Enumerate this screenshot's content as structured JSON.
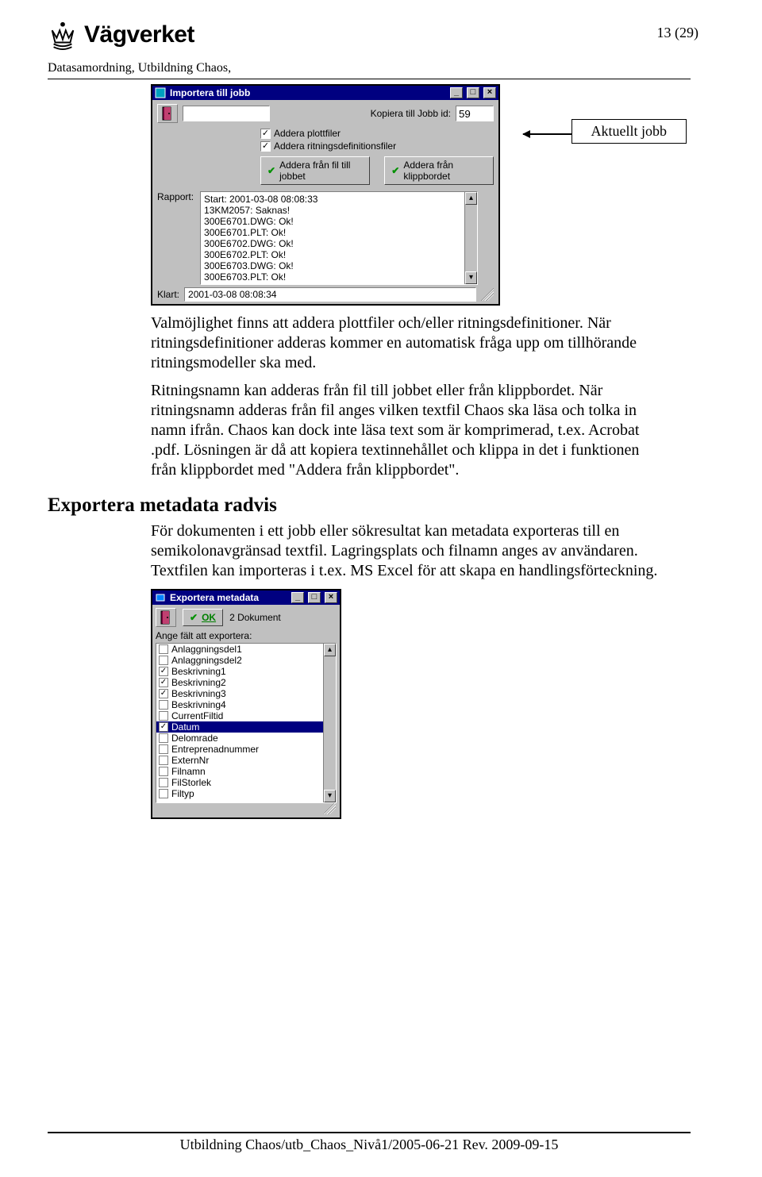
{
  "header": {
    "logo_text": "Vägverket",
    "page_number": "13 (29)",
    "doc_meta": "Datasamordning, Utbildning Chaos,"
  },
  "callout": {
    "label": "Aktuellt jobb"
  },
  "window1": {
    "title": "Importera till jobb",
    "jobid_label": "Kopiera till Jobb id:",
    "jobid_value": "59",
    "chk1": "Addera plottfiler",
    "chk2": "Addera ritningsdefinitionsfiler",
    "btn1": "Addera från fil till jobbet",
    "btn2": "Addera från klippbordet",
    "rpt_label": "Rapport:",
    "rpt_lines": [
      "Start: 2001-03-08 08:08:33",
      "13KM2057: Saknas!",
      "300E6701.DWG: Ok!",
      "300E6701.PLT: Ok!",
      "300E6702.DWG: Ok!",
      "300E6702.PLT: Ok!",
      "300E6703.DWG: Ok!",
      "300E6703.PLT: Ok!"
    ],
    "status_label": "Klart:",
    "status_value": "2001-03-08 08:08:34"
  },
  "paragraphs": {
    "p1": "Valmöjlighet finns att addera plottfiler och/eller ritningsdefinitioner. När ritningsdefinitioner adderas kommer en automatisk fråga upp om tillhörande ritningsmodeller ska med.",
    "p2": "Ritningsnamn kan adderas från fil till jobbet eller från klippbordet. När ritningsnamn adderas från fil anges vilken textfil Chaos ska läsa och tolka in namn ifrån. Chaos kan dock inte läsa text som är komprimerad, t.ex. Acrobat .pdf. Lösningen är då att kopiera textinnehållet och klippa in det i funktionen från klippbordet med \"Addera från klippbordet\".",
    "h2": "Exportera metadata radvis",
    "p3": "För dokumenten i ett jobb eller sökresultat kan metadata exporteras till en semikolonavgränsad textfil. Lagringsplats och filnamn anges av användaren. Textfilen kan importeras i t.ex. MS Excel för att skapa en handlingsförteckning."
  },
  "window2": {
    "title": "Exportera metadata",
    "ok": "OK",
    "doc_count": "2 Dokument",
    "field_label": "Ange fält att exportera:",
    "items": [
      {
        "label": "Anlaggningsdel1",
        "checked": false,
        "selected": false
      },
      {
        "label": "Anlaggningsdel2",
        "checked": false,
        "selected": false
      },
      {
        "label": "Beskrivning1",
        "checked": true,
        "selected": false
      },
      {
        "label": "Beskrivning2",
        "checked": true,
        "selected": false
      },
      {
        "label": "Beskrivning3",
        "checked": true,
        "selected": false
      },
      {
        "label": "Beskrivning4",
        "checked": false,
        "selected": false
      },
      {
        "label": "CurrentFiltid",
        "checked": false,
        "selected": false
      },
      {
        "label": "Datum",
        "checked": true,
        "selected": true
      },
      {
        "label": "Delomrade",
        "checked": false,
        "selected": false
      },
      {
        "label": "Entreprenadnummer",
        "checked": false,
        "selected": false
      },
      {
        "label": "ExternNr",
        "checked": false,
        "selected": false
      },
      {
        "label": "Filnamn",
        "checked": false,
        "selected": false
      },
      {
        "label": "FilStorlek",
        "checked": false,
        "selected": false
      },
      {
        "label": "Filtyp",
        "checked": false,
        "selected": false
      }
    ]
  },
  "footer": {
    "text": "Utbildning Chaos/utb_Chaos_Nivå1/2005-06-21 Rev. 2009-09-15"
  }
}
